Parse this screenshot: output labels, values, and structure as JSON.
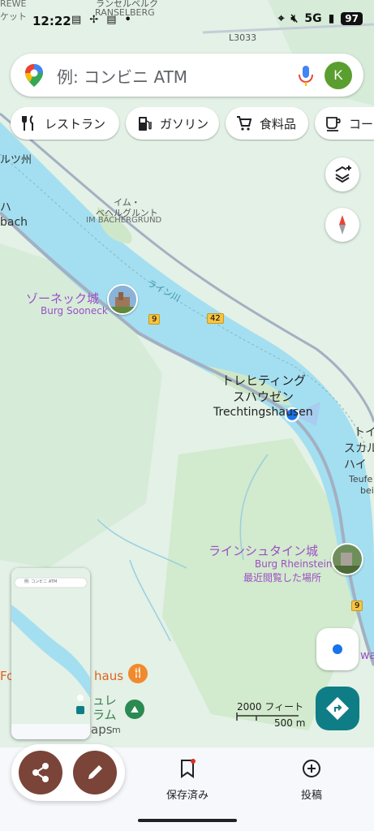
{
  "status_bar": {
    "time": "12:22",
    "network": "5G",
    "battery": "97"
  },
  "search": {
    "placeholder": "例: コンビニ ATM",
    "avatar_letter": "K"
  },
  "chips": [
    {
      "label": "レストラン",
      "icon": "restaurant-icon"
    },
    {
      "label": "ガソリン",
      "icon": "gas-station-icon"
    },
    {
      "label": "食料品",
      "icon": "cart-icon"
    },
    {
      "label": "コーヒ",
      "icon": "coffee-icon"
    }
  ],
  "map": {
    "top_labels": {
      "rewe": "REWE",
      "rewe_sub": "ケット",
      "ranselberg_ja": "ランセルベルク",
      "ranselberg": "RANSELBERG",
      "road_l3033": "L3033"
    },
    "left_edge": {
      "l1": "ルツ州",
      "l2": "ハ",
      "l3": "bach"
    },
    "im_bachergrund_ja1": "イム・",
    "im_bachergrund_ja2": "ベヘルグルント",
    "im_bachergrund": "IM BÄCHERGRUND",
    "river_label": "ライン川",
    "burg_sooneck_ja": "ゾーネック城",
    "burg_sooneck": "Burg Sooneck",
    "road_9": "9",
    "road_42": "42",
    "town_ja1": "トレヒティング",
    "town_ja2": "スハウゼン",
    "town": "Trechtingshausen",
    "right_edge": {
      "r1": "トイ",
      "r2": "スカル",
      "r3": "ハイ",
      "r4": "Teufe",
      "r5": "bei"
    },
    "rheinstein_ja": "ラインシュタイン城",
    "rheinstein": "Burg Rheinstein",
    "rheinstein_note": "最近閲覧した場所",
    "road_9b": "9",
    "forsthaus_left": "Fo",
    "forsthaus_right": "haus",
    "other1": "ュレ",
    "other2": "ラム",
    "maps_watermark": "aps",
    "maps_watermark2": "m",
    "wa": "wa",
    "scale_ft": "2000 フィート",
    "scale_m": "500 m"
  },
  "mini_preview": {
    "search": "例: コンビニ ATM"
  },
  "bottom_nav": {
    "saved": "保存済み",
    "post": "投稿"
  },
  "colors": {
    "river": "#a3dff0",
    "land": "#e3f1e6",
    "accent_teal": "#0f7d86",
    "fab_brown": "#7a4438",
    "poi_purple": "#9c4fc6",
    "location_blue": "#1a73e8"
  }
}
